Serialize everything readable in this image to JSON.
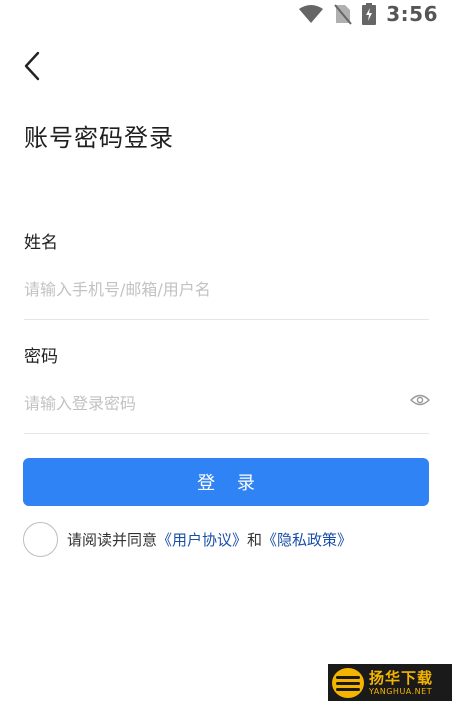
{
  "status_bar": {
    "time": "3:56"
  },
  "header": {
    "title": "账号密码登录"
  },
  "form": {
    "username": {
      "label": "姓名",
      "placeholder": "请输入手机号/邮箱/用户名",
      "value": ""
    },
    "password": {
      "label": "密码",
      "placeholder": "请输入登录密码",
      "value": ""
    },
    "submit_label": "登 录"
  },
  "agreement": {
    "prefix": "请阅读并同意",
    "user_agreement": "《用户协议》",
    "and": "和",
    "privacy_policy": "《隐私政策》",
    "checked": false
  },
  "watermark": {
    "cn": "扬华下载",
    "en": "YANGHUA.NET"
  },
  "colors": {
    "primary": "#2f83f5",
    "link": "#1a4fa8",
    "placeholder": "#c2c2c2"
  }
}
